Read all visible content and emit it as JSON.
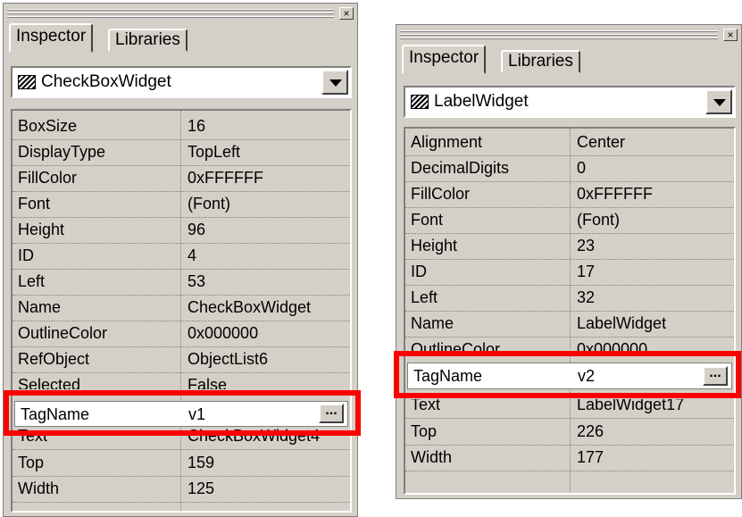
{
  "colors": {
    "highlight": "#ff0000",
    "panel_bg": "#d4d0c8"
  },
  "left_panel": {
    "tabs": [
      "Inspector",
      "Libraries"
    ],
    "close_icon": "close-icon",
    "widget_type": "CheckBoxWidget",
    "properties": [
      {
        "name": "BoxSize",
        "value": "16"
      },
      {
        "name": "DisplayType",
        "value": "TopLeft"
      },
      {
        "name": "FillColor",
        "value": "0xFFFFFF"
      },
      {
        "name": "Font",
        "value": "(Font)"
      },
      {
        "name": "Height",
        "value": "96"
      },
      {
        "name": "ID",
        "value": "4"
      },
      {
        "name": "Left",
        "value": "53"
      },
      {
        "name": "Name",
        "value": "CheckBoxWidget"
      },
      {
        "name": "OutlineColor",
        "value": "0x000000"
      },
      {
        "name": "RefObject",
        "value": "ObjectList6"
      },
      {
        "name": "Selected",
        "value": "False"
      },
      {
        "name": "TagName",
        "value": "v1"
      },
      {
        "name": "Text",
        "value": "CheckBoxWidget4"
      },
      {
        "name": "Top",
        "value": "159"
      },
      {
        "name": "Width",
        "value": "125"
      }
    ],
    "ellipsis_label": "..."
  },
  "right_panel": {
    "tabs": [
      "Inspector",
      "Libraries"
    ],
    "close_icon": "close-icon",
    "widget_type": "LabelWidget",
    "properties": [
      {
        "name": "Alignment",
        "value": "Center"
      },
      {
        "name": "DecimalDigits",
        "value": "0"
      },
      {
        "name": "FillColor",
        "value": "0xFFFFFF"
      },
      {
        "name": "Font",
        "value": "(Font)"
      },
      {
        "name": "Height",
        "value": "23"
      },
      {
        "name": "ID",
        "value": "17"
      },
      {
        "name": "Left",
        "value": "32"
      },
      {
        "name": "Name",
        "value": "LabelWidget"
      },
      {
        "name": "OutlineColor",
        "value": "0x000000"
      },
      {
        "name": "TagName",
        "value": "v2"
      },
      {
        "name": "Text",
        "value": "LabelWidget17"
      },
      {
        "name": "Top",
        "value": "226"
      },
      {
        "name": "Width",
        "value": "177"
      }
    ],
    "ellipsis_label": "..."
  }
}
